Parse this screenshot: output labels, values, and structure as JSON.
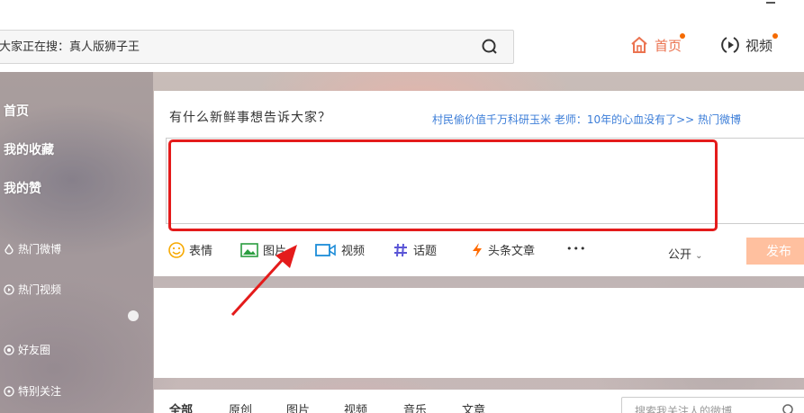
{
  "search": {
    "placeholder": "大家正在搜：真人版狮子王"
  },
  "nav": {
    "home": "首页",
    "video": "视频"
  },
  "sidebar": {
    "items": [
      "首页",
      "我的收藏",
      "我的赞"
    ],
    "sub_items": [
      "热门微博",
      "热门视频",
      "好友圈",
      "特别关注"
    ]
  },
  "publisher": {
    "title": "有什么新鲜事想告诉大家？",
    "hot_topic": "村民偷价值千万科研玉米 老师：10年的心血没有了>>  热门微博",
    "tools": [
      "表情",
      "图片",
      "视频",
      "话题",
      "头条文章",
      "•••"
    ],
    "privacy": "公开",
    "publish": "发布"
  },
  "feed": {
    "tabs": [
      "全部",
      "原创",
      "图片",
      "视频",
      "音乐",
      "文章"
    ],
    "search_placeholder": "搜索我关注人的微博"
  },
  "colors": {
    "accent": "#eb7350",
    "annotation": "#e41b1b",
    "publish_disabled": "#ffc09f",
    "link": "#3b7dd8"
  }
}
